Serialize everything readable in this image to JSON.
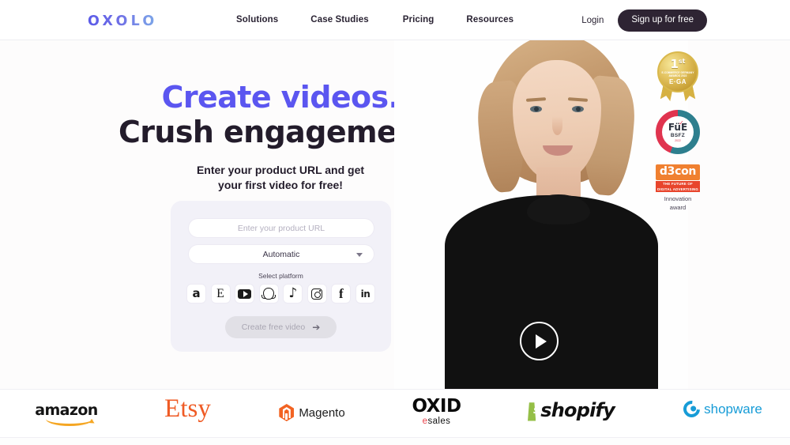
{
  "nav": {
    "logo": "OXOLO",
    "links": [
      {
        "label": "Solutions"
      },
      {
        "label": "Case Studies"
      },
      {
        "label": "Pricing"
      },
      {
        "label": "Resources"
      }
    ],
    "login_label": "Login",
    "signup_label": "Sign up for free"
  },
  "hero": {
    "headline_line1": "Create videos.",
    "headline_line2": "Crush engagement.",
    "headline_color_1": "#5B56F0",
    "headline_color_2": "#231C2B",
    "subhead_line1": "Enter your product URL and get",
    "subhead_line2": "your first video for free!",
    "form": {
      "url_placeholder": "Enter your product URL",
      "url_value": "",
      "select_value": "Automatic",
      "select_options": [
        "Automatic"
      ],
      "platform_label": "Select platform",
      "platforms": [
        {
          "name": "amazon-icon",
          "glyph": "a"
        },
        {
          "name": "etsy-icon",
          "glyph": "E"
        },
        {
          "name": "youtube-icon",
          "glyph": ""
        },
        {
          "name": "snapchat-icon",
          "glyph": ""
        },
        {
          "name": "tiktok-icon",
          "glyph": "♪"
        },
        {
          "name": "instagram-icon",
          "glyph": ""
        },
        {
          "name": "facebook-icon",
          "glyph": "f"
        },
        {
          "name": "linkedin-icon",
          "glyph": "in"
        }
      ],
      "cta_label": "Create free video",
      "cta_arrow": "➔",
      "cta_disabled": true
    },
    "video": {
      "play_label": "Play video"
    }
  },
  "badges": [
    {
      "name": "ega-award-badge",
      "rank": "1",
      "rank_suffix": "st",
      "line_small": "E-COMMERCE GERMANY AWARDS 2022",
      "acronym": "E·GA",
      "color": "#D9B84C"
    },
    {
      "name": "fue-bsfz-badge",
      "main": "FüE",
      "sub": "BSFZ",
      "year": "2022",
      "color_a": "#E0344F",
      "color_b": "#2E7F8E"
    },
    {
      "name": "d3con-award-badge",
      "title": "d3con",
      "tagline_line1": "THE FUTURE OF",
      "tagline_line2": "DIGITAL ADVERTISING",
      "caption_line1": "Innovation",
      "caption_line2": "award",
      "color": "#F08030"
    }
  ],
  "logo_bar": {
    "brands": [
      {
        "name": "amazon",
        "label": "amazon",
        "color": "#141414"
      },
      {
        "name": "etsy",
        "label": "Etsy",
        "color": "#EF5B25"
      },
      {
        "name": "magento",
        "label": "Magento",
        "color": "#F26322"
      },
      {
        "name": "oxid-esales",
        "label": "OXID",
        "sub_a": "e",
        "sub_b": "sales",
        "color": "#0A0A0A"
      },
      {
        "name": "shopify",
        "label": "shopify",
        "color": "#95BF47"
      },
      {
        "name": "shopware",
        "label": "shopware",
        "color": "#179CD7"
      }
    ]
  }
}
